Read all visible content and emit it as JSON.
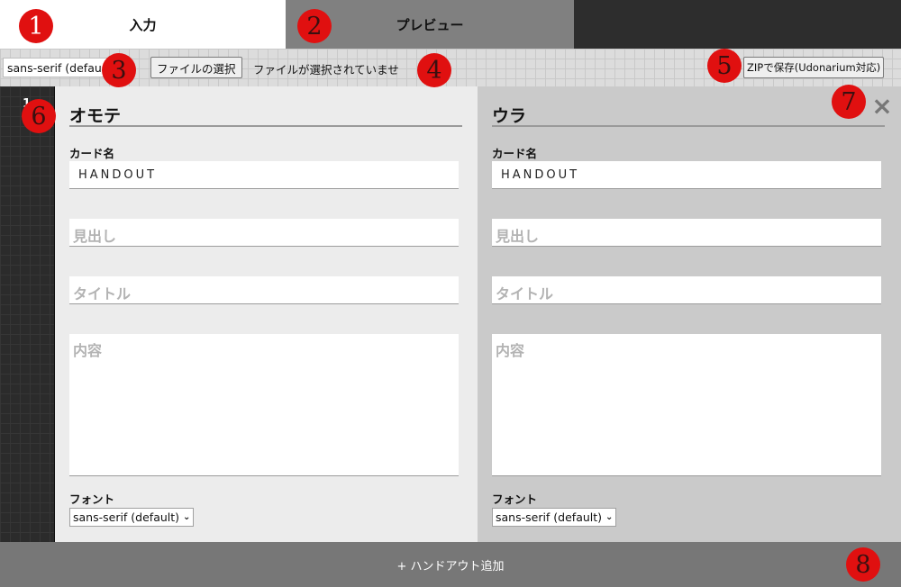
{
  "tabs": {
    "input": "入力",
    "preview": "プレビュー"
  },
  "toolbar": {
    "font_select_value": "sans-serif (defau",
    "file_button_label": "ファイルの選択",
    "file_status": "ファイルが選択されていませ",
    "zip_button_label": "ZIPで保存(Udonarium対応)"
  },
  "card": {
    "number": "1",
    "front": {
      "heading": "オモテ",
      "name_label": "カード名",
      "name_value": "HANDOUT",
      "heading_placeholder": "見出し",
      "title_placeholder": "タイトル",
      "content_placeholder": "内容",
      "font_label": "フォント",
      "font_value": "sans-serif (default)"
    },
    "back": {
      "heading": "ウラ",
      "name_label": "カード名",
      "name_value": "HANDOUT",
      "heading_placeholder": "見出し",
      "title_placeholder": "タイトル",
      "content_placeholder": "内容",
      "font_label": "フォント",
      "font_value": "sans-serif (default)"
    },
    "close_icon": "×"
  },
  "bottom": {
    "add_label": "+ ハンドアウト追加"
  },
  "markers": [
    "1",
    "2",
    "3",
    "4",
    "5",
    "6",
    "7",
    "8"
  ],
  "colors": {
    "marker": "#e01010",
    "tab_active": "#ffffff",
    "tab_inactive": "#808080",
    "bottom_bar": "#777777"
  }
}
